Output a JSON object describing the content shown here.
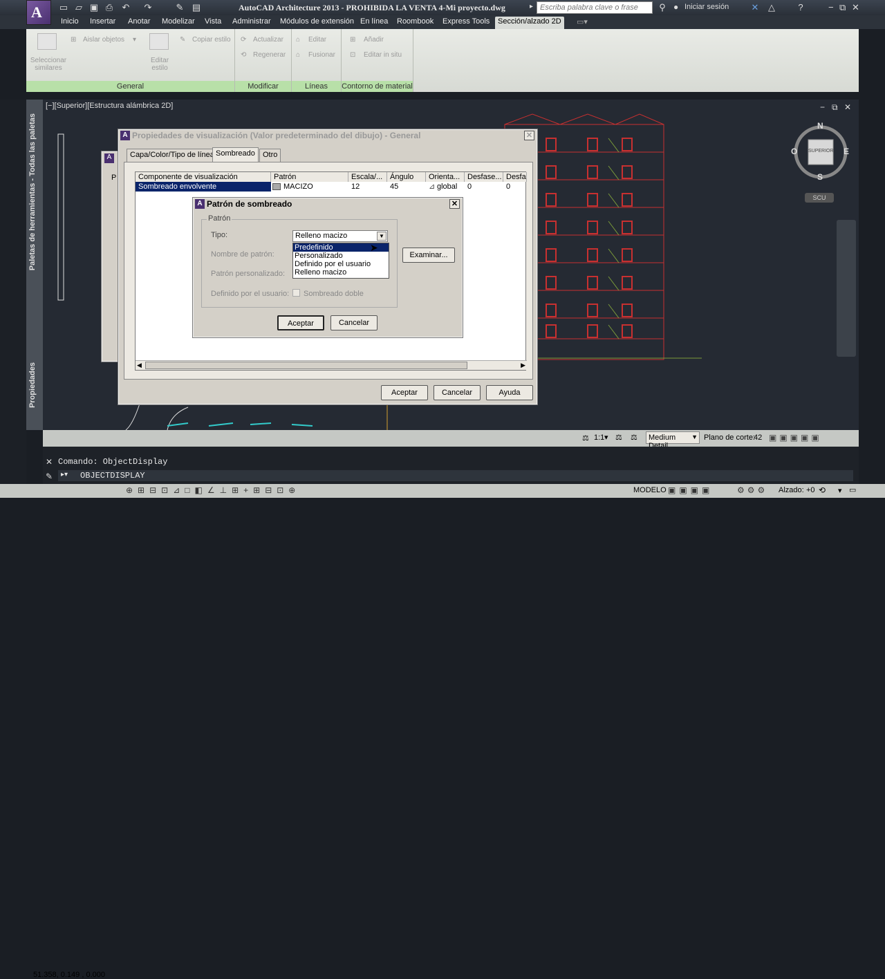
{
  "titlebar": {
    "title": "AutoCAD Architecture 2013 - PROHIBIDA LA VENTA   4-Mi proyecto.dwg",
    "search_placeholder": "Escriba palabra clave o frase",
    "signin": "Iniciar sesión"
  },
  "ribbon_tabs": [
    "Inicio",
    "Insertar",
    "Anotar",
    "Modelizar",
    "Vista",
    "Administrar",
    "Módulos de extensión",
    "En línea",
    "Roombook",
    "Express Tools",
    "Sección/alzado 2D"
  ],
  "ribbon": {
    "general": {
      "label": "General",
      "select_similar": "Seleccionar similares",
      "isolate": "Aislar objetos",
      "edit_style": "Editar estilo",
      "copy_style": "Copiar estilo"
    },
    "modify": {
      "label": "Modificar",
      "update": "Actualizar",
      "regenerate": "Regenerar"
    },
    "lines": {
      "label": "Líneas",
      "edit": "Editar",
      "merge": "Fusionar"
    },
    "material": {
      "label": "Contorno de material",
      "add": "Añadir",
      "edit_in_place": "Editar in situ"
    }
  },
  "viewport": {
    "label": "[−][Superior][Estructura alámbrica 2D]",
    "viewcube_face": "SUPERIOR",
    "compass": {
      "n": "N",
      "s": "S",
      "e": "E",
      "o": "O"
    },
    "ucs": "SCU"
  },
  "side_palettes": {
    "tools": "Paletas de herramientas - Todas las paletas",
    "properties": "Propiedades"
  },
  "display_dialog": {
    "title": "Propiedades de visualización (Valor predeterminado del dibujo) - General",
    "tabs": [
      "Capa/Color/Tipo de línea",
      "Sombreado",
      "Otro"
    ],
    "columns": [
      "Componente de visualización",
      "Patrón",
      "Escala/...",
      "Ángulo",
      "Orienta...",
      "Desfase...",
      "Desfa"
    ],
    "row": {
      "component": "Sombreado envolvente",
      "pattern": "MACIZO",
      "scale": "12",
      "angle": "45",
      "orient": "global",
      "offset1": "0",
      "offset2": "0"
    },
    "ok": "Aceptar",
    "cancel": "Cancelar",
    "help": "Ayuda"
  },
  "behind_dialog": {
    "text": "P"
  },
  "hatch_dialog": {
    "title": "Patrón de sombreado",
    "group": "Patrón",
    "type_label": "Tipo:",
    "type_value": "Relleno macizo",
    "pattern_name_label": "Nombre de patrón:",
    "custom_pattern_label": "Patrón personalizado:",
    "user_defined_label": "Definido por el usuario:",
    "double_hatch": "Sombreado doble",
    "browse": "Examinar...",
    "ok": "Aceptar",
    "cancel": "Cancelar",
    "options": [
      "Predefinido",
      "Personalizado",
      "Definido por el usuario",
      "Relleno macizo"
    ]
  },
  "status": {
    "scale": "1:1",
    "detail": "Medium Detail",
    "cut_plane": "Plano de corte:",
    "cut_value": "42",
    "model": "MODELO",
    "elevation": "Alzado:",
    "elevation_value": "+0",
    "coords": "51.358, 0.149 , 0.000"
  },
  "command": {
    "history": "Comando: ObjectDisplay",
    "input": "OBJECTDISPLAY"
  }
}
